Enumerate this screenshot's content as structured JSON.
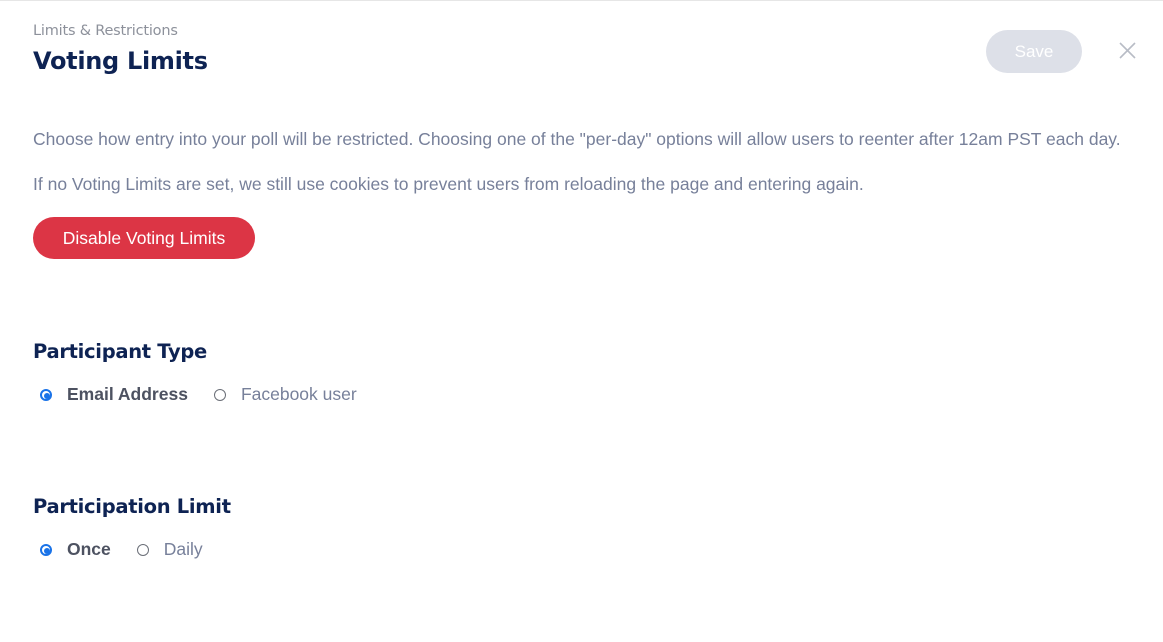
{
  "header": {
    "breadcrumb": "Limits & Restrictions",
    "title": "Voting Limits",
    "save_label": "Save",
    "close_icon": "close-icon"
  },
  "description": {
    "line1": "Choose how entry into your poll will be restricted. Choosing one of the \"per-day\" options will allow users to reenter after 12am PST each day.",
    "line2": "If no Voting Limits are set, we still use cookies to prevent users from reloading the page and entering again."
  },
  "disable_button": {
    "label": "Disable Voting Limits",
    "color": "#dc3545"
  },
  "participant_type": {
    "title": "Participant Type",
    "options": [
      {
        "label": "Email Address",
        "selected": true
      },
      {
        "label": "Facebook user",
        "selected": false
      }
    ]
  },
  "participation_limit": {
    "title": "Participation Limit",
    "options": [
      {
        "label": "Once",
        "selected": true
      },
      {
        "label": "Daily",
        "selected": false
      }
    ]
  },
  "colors": {
    "accent": "#1a73e8",
    "heading": "#0e2353",
    "body_text": "#77809a",
    "save_disabled": "#dde0e8"
  }
}
